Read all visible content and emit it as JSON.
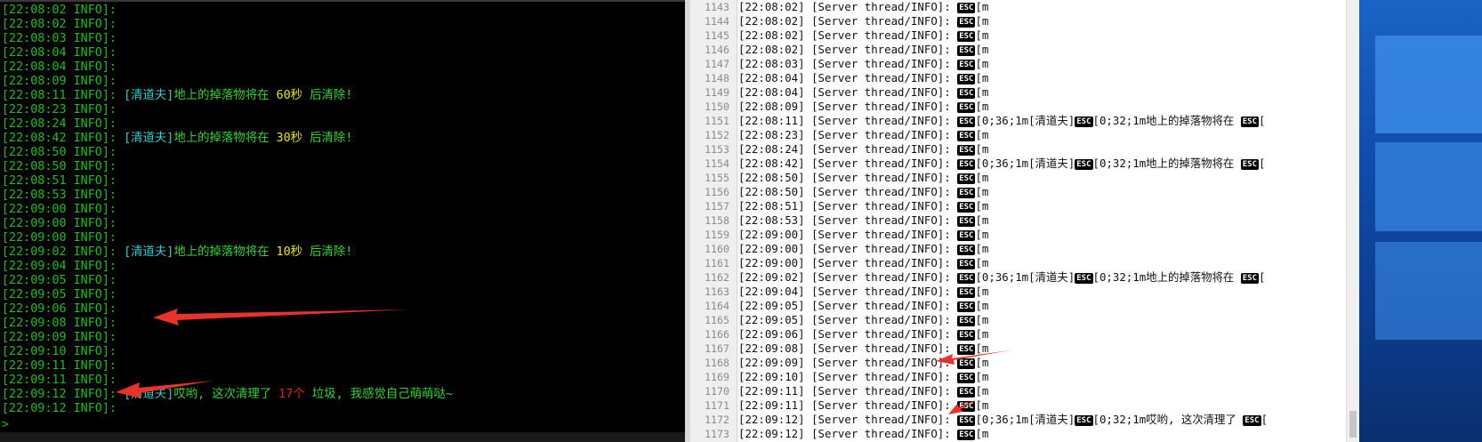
{
  "console": {
    "lines": [
      {
        "ts": "[22:08:02 INFO]:",
        "parts": []
      },
      {
        "ts": "[22:08:02 INFO]:",
        "parts": []
      },
      {
        "ts": "[22:08:03 INFO]:",
        "parts": []
      },
      {
        "ts": "[22:08:04 INFO]:",
        "parts": []
      },
      {
        "ts": "[22:08:04 INFO]:",
        "parts": []
      },
      {
        "ts": "[22:08:09 INFO]:",
        "parts": []
      },
      {
        "ts": "[22:08:11 INFO]:",
        "parts": [
          {
            "t": "[清道夫]",
            "c": "tag"
          },
          {
            "t": "地上的掉落物将在 ",
            "c": "msg"
          },
          {
            "t": "60秒",
            "c": "num-y"
          },
          {
            "t": " 后清除!",
            "c": "msg"
          }
        ]
      },
      {
        "ts": "[22:08:23 INFO]:",
        "parts": []
      },
      {
        "ts": "[22:08:24 INFO]:",
        "parts": []
      },
      {
        "ts": "[22:08:42 INFO]:",
        "parts": [
          {
            "t": "[清道夫]",
            "c": "tag"
          },
          {
            "t": "地上的掉落物将在 ",
            "c": "msg"
          },
          {
            "t": "30秒",
            "c": "num-y"
          },
          {
            "t": " 后清除!",
            "c": "msg"
          }
        ]
      },
      {
        "ts": "[22:08:50 INFO]:",
        "parts": []
      },
      {
        "ts": "[22:08:50 INFO]:",
        "parts": []
      },
      {
        "ts": "[22:08:51 INFO]:",
        "parts": []
      },
      {
        "ts": "[22:08:53 INFO]:",
        "parts": []
      },
      {
        "ts": "[22:09:00 INFO]:",
        "parts": []
      },
      {
        "ts": "[22:09:00 INFO]:",
        "parts": []
      },
      {
        "ts": "[22:09:00 INFO]:",
        "parts": []
      },
      {
        "ts": "[22:09:02 INFO]:",
        "parts": [
          {
            "t": "[清道夫]",
            "c": "tag"
          },
          {
            "t": "地上的掉落物将在 ",
            "c": "msg"
          },
          {
            "t": "10秒",
            "c": "num-y"
          },
          {
            "t": " 后清除!",
            "c": "msg"
          }
        ]
      },
      {
        "ts": "[22:09:04 INFO]:",
        "parts": []
      },
      {
        "ts": "[22:09:05 INFO]:",
        "parts": []
      },
      {
        "ts": "[22:09:05 INFO]:",
        "parts": []
      },
      {
        "ts": "[22:09:06 INFO]:",
        "parts": []
      },
      {
        "ts": "[22:09:08 INFO]:",
        "parts": []
      },
      {
        "ts": "[22:09:09 INFO]:",
        "parts": []
      },
      {
        "ts": "[22:09:10 INFO]:",
        "parts": []
      },
      {
        "ts": "[22:09:11 INFO]:",
        "parts": []
      },
      {
        "ts": "[22:09:11 INFO]:",
        "parts": []
      },
      {
        "ts": "[22:09:12 INFO]:",
        "parts": [
          {
            "t": "[清道夫]",
            "c": "tag"
          },
          {
            "t": "哎哟, 这次清理了 ",
            "c": "msg"
          },
          {
            "t": "17个",
            "c": "num-r"
          },
          {
            "t": " 垃圾, 我感觉自己萌萌哒~",
            "c": "msg"
          }
        ]
      },
      {
        "ts": "[22:09:12 INFO]:",
        "parts": []
      }
    ],
    "prompt": ">"
  },
  "editor": {
    "esc_label": "ESC",
    "rows": [
      {
        "n": "1143",
        "ts": "[22:08:02]",
        "tail": "[m"
      },
      {
        "n": "1144",
        "ts": "[22:08:02]",
        "tail": "[m"
      },
      {
        "n": "1145",
        "ts": "[22:08:02]",
        "tail": "[m"
      },
      {
        "n": "1146",
        "ts": "[22:08:02]",
        "tail": "[m"
      },
      {
        "n": "1147",
        "ts": "[22:08:03]",
        "tail": "[m"
      },
      {
        "n": "1148",
        "ts": "[22:08:04]",
        "tail": "[m"
      },
      {
        "n": "1149",
        "ts": "[22:08:04]",
        "tail": "[m"
      },
      {
        "n": "1150",
        "ts": "[22:08:09]",
        "tail": "[m"
      },
      {
        "n": "1151",
        "ts": "[22:08:11]",
        "tail": "[0;36;1m[清道夫]",
        "mid": "[0;32;1m地上的掉落物将在 ",
        "end": "["
      },
      {
        "n": "1152",
        "ts": "[22:08:23]",
        "tail": "[m"
      },
      {
        "n": "1153",
        "ts": "[22:08:24]",
        "tail": "[m"
      },
      {
        "n": "1154",
        "ts": "[22:08:42]",
        "tail": "[0;36;1m[清道夫]",
        "mid": "[0;32;1m地上的掉落物将在 ",
        "end": "["
      },
      {
        "n": "1155",
        "ts": "[22:08:50]",
        "tail": "[m"
      },
      {
        "n": "1156",
        "ts": "[22:08:50]",
        "tail": "[m"
      },
      {
        "n": "1157",
        "ts": "[22:08:51]",
        "tail": "[m"
      },
      {
        "n": "1158",
        "ts": "[22:08:53]",
        "tail": "[m"
      },
      {
        "n": "1159",
        "ts": "[22:09:00]",
        "tail": "[m"
      },
      {
        "n": "1160",
        "ts": "[22:09:00]",
        "tail": "[m"
      },
      {
        "n": "1161",
        "ts": "[22:09:00]",
        "tail": "[m"
      },
      {
        "n": "1162",
        "ts": "[22:09:02]",
        "tail": "[0;36;1m[清道夫]",
        "mid": "[0;32;1m地上的掉落物将在 ",
        "end": "["
      },
      {
        "n": "1163",
        "ts": "[22:09:04]",
        "tail": "[m"
      },
      {
        "n": "1164",
        "ts": "[22:09:05]",
        "tail": "[m"
      },
      {
        "n": "1165",
        "ts": "[22:09:05]",
        "tail": "[m"
      },
      {
        "n": "1166",
        "ts": "[22:09:06]",
        "tail": "[m"
      },
      {
        "n": "1167",
        "ts": "[22:09:08]",
        "tail": "[m"
      },
      {
        "n": "1168",
        "ts": "[22:09:09]",
        "tail": "[m"
      },
      {
        "n": "1169",
        "ts": "[22:09:10]",
        "tail": "[m"
      },
      {
        "n": "1170",
        "ts": "[22:09:11]",
        "tail": "[m"
      },
      {
        "n": "1171",
        "ts": "[22:09:11]",
        "tail": "[m"
      },
      {
        "n": "1172",
        "ts": "[22:09:12]",
        "tail": "[0;36;1m[清道夫]",
        "mid": "[0;32;1m哎哟, 这次清理了 ",
        "end": "["
      },
      {
        "n": "1173",
        "ts": "[22:09:12]",
        "tail": "[m"
      }
    ],
    "thread_label": " [Server thread/INFO]: "
  },
  "colors": {
    "console_bg": "#000000",
    "console_text": "#18c018",
    "tag": "#33cccc",
    "highlight_yellow": "#e8e800",
    "highlight_red": "#e02020",
    "arrow": "#e8322a"
  }
}
